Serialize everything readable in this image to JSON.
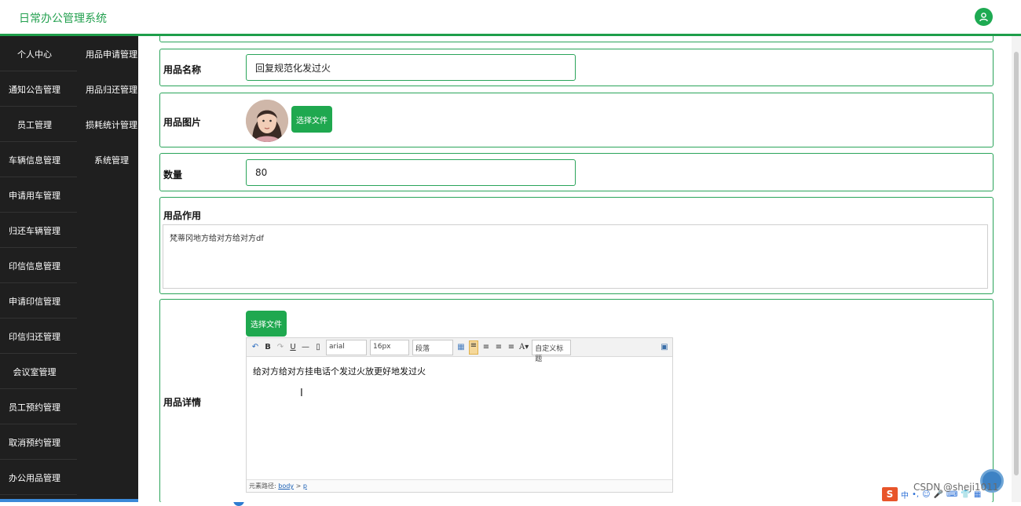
{
  "header": {
    "title": "日常办公管理系统"
  },
  "sidebar": {
    "left": [
      "个人中心",
      "通知公告管理",
      "员工管理",
      "车辆信息管理",
      "申请用车管理",
      "归还车辆管理",
      "印信信息管理",
      "申请印信管理",
      "印信归还管理",
      "会议室管理",
      "员工预约管理",
      "取消预约管理",
      "办公用品管理"
    ],
    "right": [
      "用品申请管理",
      "用品归还管理",
      "损耗统计管理",
      "系统管理"
    ]
  },
  "form": {
    "name_label": "用品名称",
    "name_value": "回复规范化发过火",
    "image_label": "用品图片",
    "choose_file": "选择文件",
    "quantity_label": "数量",
    "quantity_value": "80",
    "purpose_label": "用品作用",
    "purpose_value": "梵蒂冈地方给对方给对方df",
    "detail_label": "用品详情",
    "detail_choose_file": "选择文件"
  },
  "editor": {
    "font_family": "arial",
    "font_size": "16px",
    "paragraph": "段落",
    "custom_title": "自定义标题",
    "content": "给对方给对方挂电话个发过火放更好地发过火",
    "path_label": "元素路径:",
    "path_body": "body",
    "path_sep": ">",
    "path_p": "p"
  },
  "watermark": "CSDN @sheji1011",
  "tray": {
    "logo": "S",
    "lang": "中"
  }
}
